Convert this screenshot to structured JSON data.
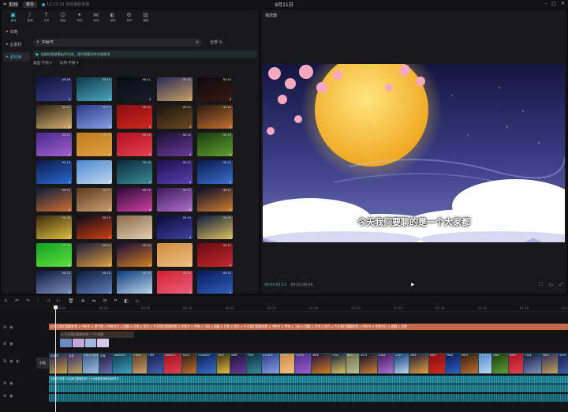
{
  "app": {
    "name": "剪映",
    "menu_label": "菜单",
    "status_text": "12:13:15 自动保存本地",
    "project_title": "9月11日",
    "window_controls": [
      "minimize-icon",
      "maximize-icon",
      "close-icon"
    ]
  },
  "tool_tabs": [
    {
      "label": "媒体",
      "icon": "media-icon",
      "active": true
    },
    {
      "label": "音频",
      "icon": "audio-icon"
    },
    {
      "label": "文本",
      "icon": "text-icon"
    },
    {
      "label": "贴纸",
      "icon": "sticker-icon"
    },
    {
      "label": "特效",
      "icon": "effects-icon"
    },
    {
      "label": "转场",
      "icon": "transition-icon"
    },
    {
      "label": "滤镜",
      "icon": "filter-icon"
    },
    {
      "label": "调节",
      "icon": "adjust-icon"
    },
    {
      "label": "模板",
      "icon": "template-icon"
    }
  ],
  "side_nav": [
    {
      "label": "本地"
    },
    {
      "label": "云素材"
    },
    {
      "label": "素材库",
      "active": true
    }
  ],
  "search": {
    "value": "中秋节",
    "all_label": "全部"
  },
  "notice": "当前检索结果由AI生成，请仔细甄别并合理使用",
  "filters": [
    {
      "label": "类型",
      "value": "不限"
    },
    {
      "label": "比例",
      "value": "不限"
    }
  ],
  "thumbnails": [
    {
      "dur": "00:16",
      "colors": [
        "#10133a",
        "#3a3f8a"
      ]
    },
    {
      "dur": "00:10",
      "colors": [
        "#0e3a4a",
        "#4aa6c0"
      ]
    },
    {
      "dur": "00:11",
      "colors": [
        "#0a0a14",
        "#1d1d2a"
      ]
    },
    {
      "dur": "00:11",
      "colors": [
        "#2a2a5a",
        "#c8a060"
      ]
    },
    {
      "dur": "00:10",
      "colors": [
        "#0a0a10",
        "#3a1a10"
      ]
    },
    {
      "dur": "00:11",
      "colors": [
        "#2a2218",
        "#d8b070"
      ]
    },
    {
      "dur": "00:11",
      "colors": [
        "#2a3a8a",
        "#8aa0e0"
      ]
    },
    {
      "dur": "00:11",
      "colors": [
        "#8a0a10",
        "#d02a20"
      ]
    },
    {
      "dur": "00:11",
      "colors": [
        "#1a1410",
        "#6a4a20"
      ]
    },
    {
      "dur": "00:11",
      "colors": [
        "#2a1a10",
        "#c07030"
      ]
    },
    {
      "dur": "00:11",
      "colors": [
        "#4a2a8a",
        "#a060d0"
      ]
    },
    {
      "dur": "00:10",
      "colors": [
        "#c07a20",
        "#e0a040"
      ]
    },
    {
      "dur": "00:10",
      "colors": [
        "#b01020",
        "#e04050"
      ]
    },
    {
      "dur": "00:12",
      "colors": [
        "#1a1030",
        "#6a3a9a"
      ]
    },
    {
      "dur": "00:10",
      "colors": [
        "#1a3a10",
        "#60a030"
      ]
    },
    {
      "dur": "00:10",
      "colors": [
        "#0a1a4a",
        "#2a6ad0"
      ]
    },
    {
      "dur": "00:11",
      "colors": [
        "#4a8ad0",
        "#c0d8f0"
      ]
    },
    {
      "dur": "00:10",
      "colors": [
        "#0a2a3a",
        "#3a8a9a"
      ]
    },
    {
      "dur": "00:11",
      "colors": [
        "#1a1050",
        "#5a40b0"
      ]
    },
    {
      "dur": "00:10",
      "colors": [
        "#0a1a4a",
        "#3a70d0"
      ]
    },
    {
      "dur": "00:11",
      "colors": [
        "#0a1a3a",
        "#d07030"
      ]
    },
    {
      "dur": "00:11",
      "colors": [
        "#5a3a20",
        "#d0a070"
      ]
    },
    {
      "dur": "00:10",
      "colors": [
        "#2a0a3a",
        "#d040a0"
      ]
    },
    {
      "dur": "00:11",
      "colors": [
        "#3a1a5a",
        "#b070d0"
      ]
    },
    {
      "dur": "00:11",
      "colors": [
        "#0a0a2a",
        "#d08030"
      ]
    },
    {
      "dur": "00:08",
      "colors": [
        "#3a2a10",
        "#e0c040"
      ]
    },
    {
      "dur": "00:10",
      "colors": [
        "#0a0a1a",
        "#d04010"
      ]
    },
    {
      "dur": "00:10",
      "colors": [
        "#8a6a4a",
        "#e0d0b0"
      ]
    },
    {
      "dur": "00:14",
      "colors": [
        "#0a0a3a",
        "#4040a0"
      ]
    },
    {
      "dur": "00:20",
      "colors": [
        "#0a1a3a",
        "#e0c060"
      ]
    },
    {
      "dur": "00:08",
      "colors": [
        "#10a020",
        "#60e040"
      ]
    },
    {
      "dur": "00:24",
      "colors": [
        "#1a1a3a",
        "#e0a040"
      ]
    },
    {
      "dur": "00:24",
      "colors": [
        "#1a0a3a",
        "#d08020"
      ]
    },
    {
      "dur": "00:10",
      "colors": [
        "#d08a40",
        "#f0c080"
      ]
    },
    {
      "dur": "00:11",
      "colors": [
        "#6a0a10",
        "#c02a30"
      ]
    },
    {
      "dur": "00:10",
      "colors": [
        "#0a1a3a",
        "#8090c0"
      ]
    },
    {
      "dur": "00:10",
      "colors": [
        "#0a1a3a",
        "#6080c0"
      ]
    },
    {
      "dur": "00:10",
      "colors": [
        "#0a3a7a",
        "#c0d8f0"
      ]
    },
    {
      "dur": "00:10",
      "colors": [
        "#d02030",
        "#f06080"
      ]
    },
    {
      "dur": "00:10",
      "colors": [
        "#0a1a5a",
        "#3060c0"
      ]
    }
  ],
  "player": {
    "header": "播放器",
    "subtitle": "今天我们要聊的是一个大家都",
    "time_current": "00:00:01:13",
    "time_total": "00:02:06:04",
    "controls": [
      "fullscreen-icon",
      "ratio-icon",
      "expand-icon"
    ]
  },
  "timeline": {
    "toolbar_icons": [
      "select-icon",
      "undo-icon",
      "redo-icon",
      "split-icon",
      "split-left-icon",
      "split-right-icon",
      "delete-icon",
      "freeze-icon",
      "mirror-icon",
      "rotate-icon",
      "crop-icon",
      "mask-icon",
      "keyframe-icon"
    ],
    "ruler": [
      "00:00",
      "00:10",
      "00:20",
      "00:30",
      "00:40",
      "00:50",
      "01:00",
      "01:10",
      "01:20",
      "01:30",
      "01:40",
      "01:50",
      "02:00"
    ],
    "cover_label": "封面",
    "text_track_caption": "A 今天我们要聊的是 A 中秋节 A 是中国 A 传统节日 A 团圆 A 月饼 A 赏月 A 今天我们要聊的是 A 中秋节 A 传统 A 习俗 A 团圆 A 月饼 A 赏月 A 今天我们要聊的是 A 中秋节 A 传统 A 习俗 A 团圆 A 月饼 A 赏月 A 今天我们要聊的是 A 中秋节 A 传统节日 A 团圆 A 月饼",
    "text_track_2_caption": "A 今天我们要聊的是一个大家都",
    "video_clips": [
      {
        "caption": "中秋节",
        "colors": [
          "#1a1a5a",
          "#d0a040"
        ]
      },
      {
        "caption": "月亮",
        "colors": [
          "#2a2a6a",
          "#c8a060"
        ]
      },
      {
        "caption": "c4a1f75d4",
        "colors": [
          "#3a5a8a",
          "#a0c0e0"
        ]
      },
      {
        "caption": "中秋",
        "colors": [
          "#1a1a3a",
          "#6a6ab0"
        ]
      },
      {
        "caption": "c8a0b58",
        "colors": [
          "#0a3a4a",
          "#40a0c0"
        ]
      },
      {
        "caption": "c7b2a",
        "colors": [
          "#5a3a20",
          "#d0a070"
        ]
      },
      {
        "caption": "c9f4",
        "colors": [
          "#1a1a4a",
          "#4060b0"
        ]
      },
      {
        "caption": "a1b2c3",
        "colors": [
          "#a01020",
          "#e04050"
        ]
      },
      {
        "caption": "b2c4",
        "colors": [
          "#2a1a10",
          "#c07030"
        ]
      },
      {
        "caption": "c1a4a5d",
        "colors": [
          "#0a1a4a",
          "#3a70d0"
        ]
      },
      {
        "caption": "d5e7",
        "colors": [
          "#3a2a10",
          "#e0c040"
        ]
      },
      {
        "caption": "e6f8",
        "colors": [
          "#1a1030",
          "#6a3a9a"
        ]
      },
      {
        "caption": "f7a9",
        "colors": [
          "#0a2a3a",
          "#3a8a9a"
        ]
      },
      {
        "caption": "a1c3e5",
        "colors": [
          "#2a3a8a",
          "#8aa0e0"
        ]
      },
      {
        "caption": "b4d6",
        "colors": [
          "#d08a40",
          "#f0c080"
        ]
      },
      {
        "caption": "c5e7b",
        "colors": [
          "#4a2a8a",
          "#a060d0"
        ]
      },
      {
        "caption": "d6f8",
        "colors": [
          "#1a0a3a",
          "#d08020"
        ]
      },
      {
        "caption": "e7a1",
        "colors": [
          "#0a1a3a",
          "#e0c060"
        ]
      },
      {
        "caption": "f8b2",
        "colors": [
          "#6a6a4a",
          "#c0c090"
        ]
      },
      {
        "caption": "a9c3",
        "colors": [
          "#0a0a2a",
          "#d08030"
        ]
      },
      {
        "caption": "b1d4",
        "colors": [
          "#3a1a5a",
          "#b070d0"
        ]
      },
      {
        "caption": "c2e5",
        "colors": [
          "#0a3a7a",
          "#c0d8f0"
        ]
      },
      {
        "caption": "d3f6",
        "colors": [
          "#1a1a3a",
          "#e0a040"
        ]
      },
      {
        "caption": "e4a7",
        "colors": [
          "#8a0a10",
          "#d02a20"
        ]
      },
      {
        "caption": "f5b8",
        "colors": [
          "#0a1a5a",
          "#3060c0"
        ]
      },
      {
        "caption": "a6c9",
        "colors": [
          "#2a1a10",
          "#c07030"
        ]
      },
      {
        "caption": "b7d1",
        "colors": [
          "#4a8ad0",
          "#c0d8f0"
        ]
      },
      {
        "caption": "c8e2",
        "colors": [
          "#1a3a10",
          "#60a030"
        ]
      },
      {
        "caption": "d9f3",
        "colors": [
          "#b01020",
          "#e04050"
        ]
      },
      {
        "caption": "e1a4",
        "colors": [
          "#0a1a3a",
          "#8090c0"
        ]
      },
      {
        "caption": "f2b5",
        "colors": [
          "#2a2a5a",
          "#c8a060"
        ]
      },
      {
        "caption": "a3c6",
        "colors": [
          "#1a1a4a",
          "#4060b0"
        ]
      }
    ],
    "audio_caption": "中秋节 配音 今天我们要聊的是一个大家都熟悉的传统节日"
  }
}
